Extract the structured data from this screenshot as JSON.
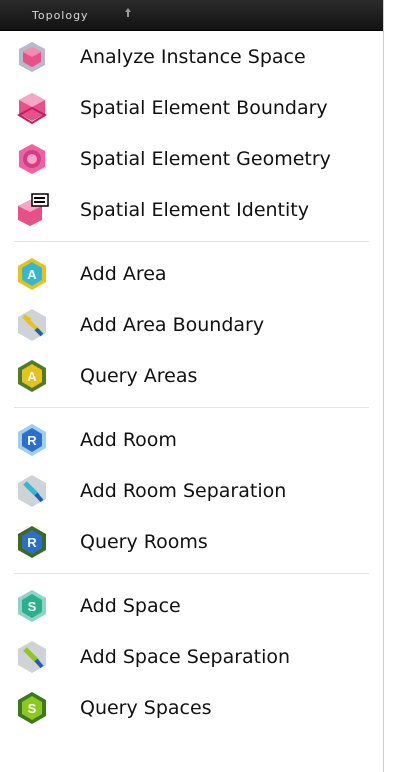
{
  "menu": {
    "title": "Topology",
    "groups": [
      {
        "items": [
          {
            "label": "Analyze Instance Space",
            "icon": "analyze-instance-space-icon"
          },
          {
            "label": "Spatial Element Boundary",
            "icon": "spatial-element-boundary-icon"
          },
          {
            "label": "Spatial Element Geometry",
            "icon": "spatial-element-geometry-icon"
          },
          {
            "label": "Spatial Element Identity",
            "icon": "spatial-element-identity-icon"
          }
        ]
      },
      {
        "items": [
          {
            "label": "Add Area",
            "icon": "add-area-icon"
          },
          {
            "label": "Add Area Boundary",
            "icon": "add-area-boundary-icon"
          },
          {
            "label": "Query Areas",
            "icon": "query-areas-icon"
          }
        ]
      },
      {
        "items": [
          {
            "label": "Add Room",
            "icon": "add-room-icon"
          },
          {
            "label": "Add Room Separation",
            "icon": "add-room-separation-icon"
          },
          {
            "label": "Query Rooms",
            "icon": "query-rooms-icon"
          }
        ]
      },
      {
        "items": [
          {
            "label": "Add Space",
            "icon": "add-space-icon"
          },
          {
            "label": "Add Space Separation",
            "icon": "add-space-separation-icon"
          },
          {
            "label": "Query Spaces",
            "icon": "query-spaces-icon"
          }
        ]
      }
    ],
    "badges": {
      "area": "A",
      "room": "R",
      "space": "S"
    },
    "colors": {
      "pink": "#e8508a",
      "area_cyan": "#35b8cf",
      "area_yellow": "#e6c21a",
      "room_blue": "#2a6fd0",
      "room_green": "#4f8a2a",
      "space_teal": "#2ab08c",
      "space_lime": "#8cc81e"
    }
  }
}
